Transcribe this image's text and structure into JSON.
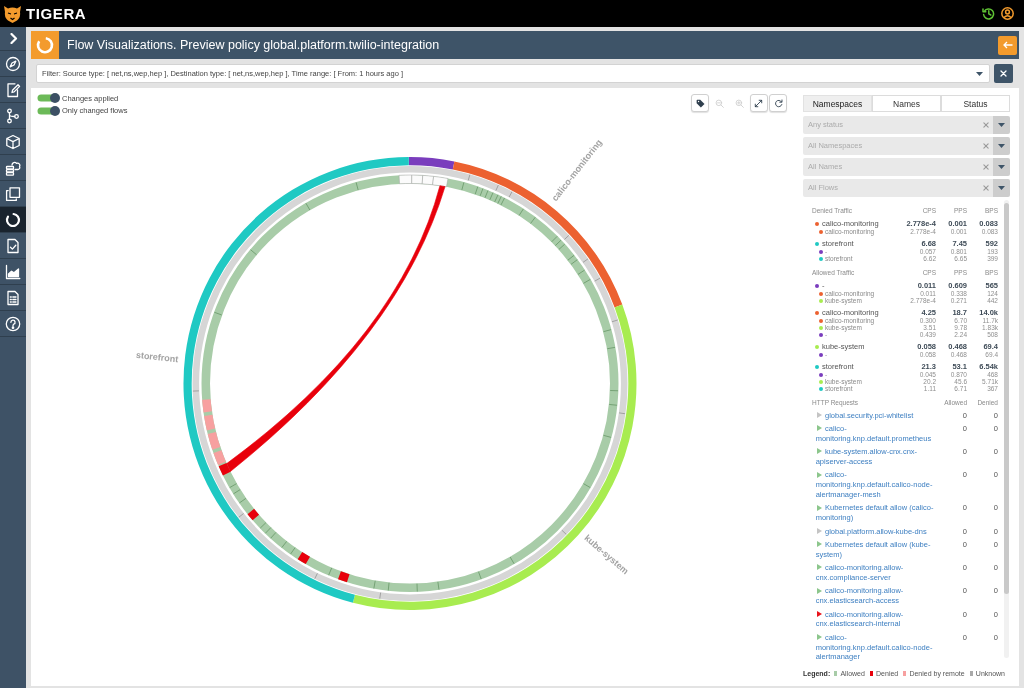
{
  "app_bar": {
    "brand": "TIGERA"
  },
  "sidebar": {
    "items": [
      {
        "selected": false
      },
      {
        "selected": false
      },
      {
        "selected": false
      },
      {
        "selected": false
      },
      {
        "selected": false
      },
      {
        "selected": false
      },
      {
        "selected": true
      },
      {
        "selected": false
      },
      {
        "selected": false
      },
      {
        "selected": false
      },
      {
        "selected": false
      }
    ]
  },
  "header": {
    "title": "Flow Visualizations. Preview policy global.platform.twilio-integration"
  },
  "filter": {
    "value": "Filter: Source type: [ net,ns,wep,hep ], Destination type: [ net,ns,wep,hep ], Time range: [ From: 1 hours ago ]"
  },
  "toggles": [
    {
      "label": "Changes applied",
      "on": true
    },
    {
      "label": "Only changed flows",
      "on": true
    }
  ],
  "chart_toolbar": [
    {
      "disabled": false
    },
    {
      "disabled": true
    },
    {
      "disabled": true
    },
    {
      "disabled": false
    },
    {
      "disabled": false
    }
  ],
  "chord": {
    "arcs": [
      {
        "color": "#7a3dbd"
      },
      {
        "label": "calico-monitoring",
        "color": "#ec6130"
      },
      {
        "label": "kube-system",
        "color": "#a8ec50"
      },
      {
        "label": "storefront",
        "color": "#1fc9c3"
      }
    ]
  },
  "tabs": [
    {
      "label": "Namespaces",
      "selected": true
    },
    {
      "label": "Names",
      "selected": false
    },
    {
      "label": "Status",
      "selected": false
    }
  ],
  "filters": [
    {
      "placeholder": "Any status"
    },
    {
      "placeholder": "All Namespaces"
    },
    {
      "placeholder": "All Names"
    },
    {
      "placeholder": "All Flows"
    }
  ],
  "traffic": [
    {
      "title": "Denied Traffic",
      "columns": [
        "CPS",
        "PPS",
        "BPS"
      ],
      "groups": [
        {
          "name": "calico-monitoring",
          "color": "#ec6130",
          "values": [
            "2.778e-4",
            "0.001",
            "0.083"
          ],
          "children": [
            {
              "name": "calico-monitoring",
              "color": "#ec6130",
              "values": [
                "2.778e-4",
                "0.001",
                "0.083"
              ]
            }
          ]
        },
        {
          "name": "storefront",
          "color": "#1fc9c3",
          "values": [
            "6.68",
            "7.45",
            "592"
          ],
          "children": [
            {
              "name": "-",
              "color": "#7a3dbd",
              "values": [
                "0.057",
                "0.801",
                "193"
              ]
            },
            {
              "name": "storefront",
              "color": "#1fc9c3",
              "values": [
                "6.62",
                "6.65",
                "399"
              ]
            }
          ]
        }
      ]
    },
    {
      "title": "Allowed Traffic",
      "columns": [
        "CPS",
        "PPS",
        "BPS"
      ],
      "groups": [
        {
          "name": "-",
          "color": "#7a3dbd",
          "values": [
            "0.011",
            "0.609",
            "565"
          ],
          "children": [
            {
              "name": "calico-monitoring",
              "color": "#ec6130",
              "values": [
                "0.011",
                "0.338",
                "124"
              ]
            },
            {
              "name": "kube-system",
              "color": "#a8ec50",
              "values": [
                "2.778e-4",
                "0.271",
                "442"
              ]
            }
          ]
        },
        {
          "name": "calico-monitoring",
          "color": "#ec6130",
          "values": [
            "4.25",
            "18.7",
            "14.0k"
          ],
          "children": [
            {
              "name": "calico-monitoring",
              "color": "#ec6130",
              "values": [
                "0.300",
                "6.70",
                "11.7k"
              ]
            },
            {
              "name": "kube-system",
              "color": "#a8ec50",
              "values": [
                "3.51",
                "9.78",
                "1.83k"
              ]
            },
            {
              "name": "-",
              "color": "#7a3dbd",
              "values": [
                "0.439",
                "2.24",
                "508"
              ]
            }
          ]
        },
        {
          "name": "kube-system",
          "color": "#a8ec50",
          "values": [
            "0.058",
            "0.468",
            "69.4"
          ],
          "children": [
            {
              "name": "-",
              "color": "#7a3dbd",
              "values": [
                "0.058",
                "0.468",
                "69.4"
              ]
            }
          ]
        },
        {
          "name": "storefront",
          "color": "#1fc9c3",
          "values": [
            "21.3",
            "53.1",
            "6.54k"
          ],
          "children": [
            {
              "name": "-",
              "color": "#7a3dbd",
              "values": [
                "0.045",
                "0.870",
                "468"
              ]
            },
            {
              "name": "kube-system",
              "color": "#a8ec50",
              "values": [
                "20.2",
                "45.6",
                "5.71k"
              ]
            },
            {
              "name": "storefront",
              "color": "#1fc9c3",
              "values": [
                "1.11",
                "6.71",
                "367"
              ]
            }
          ]
        }
      ]
    }
  ],
  "http_requests": {
    "columns": [
      "HTTP Requests",
      "Allowed",
      "Denied"
    ],
    "rows": [
      {
        "policy": "global.security.pci-whitelist",
        "color": "#c4c4c4",
        "allowed": "0",
        "denied": "0"
      },
      {
        "policy": "calico-monitoring.knp.default.prometheus",
        "color": "#8cc68c",
        "allowed": "0",
        "denied": "0"
      },
      {
        "policy": "kube-system.allow-cnx.cnx-apiserver-access",
        "color": "#8cc68c",
        "allowed": "0",
        "denied": "0"
      },
      {
        "policy": "calico-monitoring.knp.default.calico-node-alertmanager-mesh",
        "color": "#8cc68c",
        "allowed": "0",
        "denied": "0"
      },
      {
        "policy": "Kubernetes default allow (calico-monitoring)",
        "color": "#8cc68c",
        "allowed": "0",
        "denied": "0"
      },
      {
        "policy": "global.platform.allow-kube-dns",
        "color": "#c4c4c4",
        "allowed": "0",
        "denied": "0"
      },
      {
        "policy": "Kubernetes default allow (kube-system)",
        "color": "#8cc68c",
        "allowed": "0",
        "denied": "0"
      },
      {
        "policy": "calico-monitoring.allow-cnx.compliance-server",
        "color": "#8cc68c",
        "allowed": "0",
        "denied": "0"
      },
      {
        "policy": "calico-monitoring.allow-cnx.elasticsearch-access",
        "color": "#8cc68c",
        "allowed": "0",
        "denied": "0"
      },
      {
        "policy": "calico-monitoring.allow-cnx.elasticsearch-internal",
        "color": "#e8141c",
        "allowed": "0",
        "denied": "0"
      },
      {
        "policy": "calico-monitoring.knp.default.calico-node-alertmanager",
        "color": "#8cc68c",
        "allowed": "0",
        "denied": "0"
      }
    ]
  },
  "legend": {
    "title": "Legend:",
    "items": [
      {
        "label": "Allowed",
        "color": "#a8cca8"
      },
      {
        "label": "Denied",
        "color": "#e8000b"
      },
      {
        "label": "Denied by remote",
        "color": "#f7a0a0"
      },
      {
        "label": "Unknown",
        "color": "#a9a9a9"
      }
    ]
  }
}
